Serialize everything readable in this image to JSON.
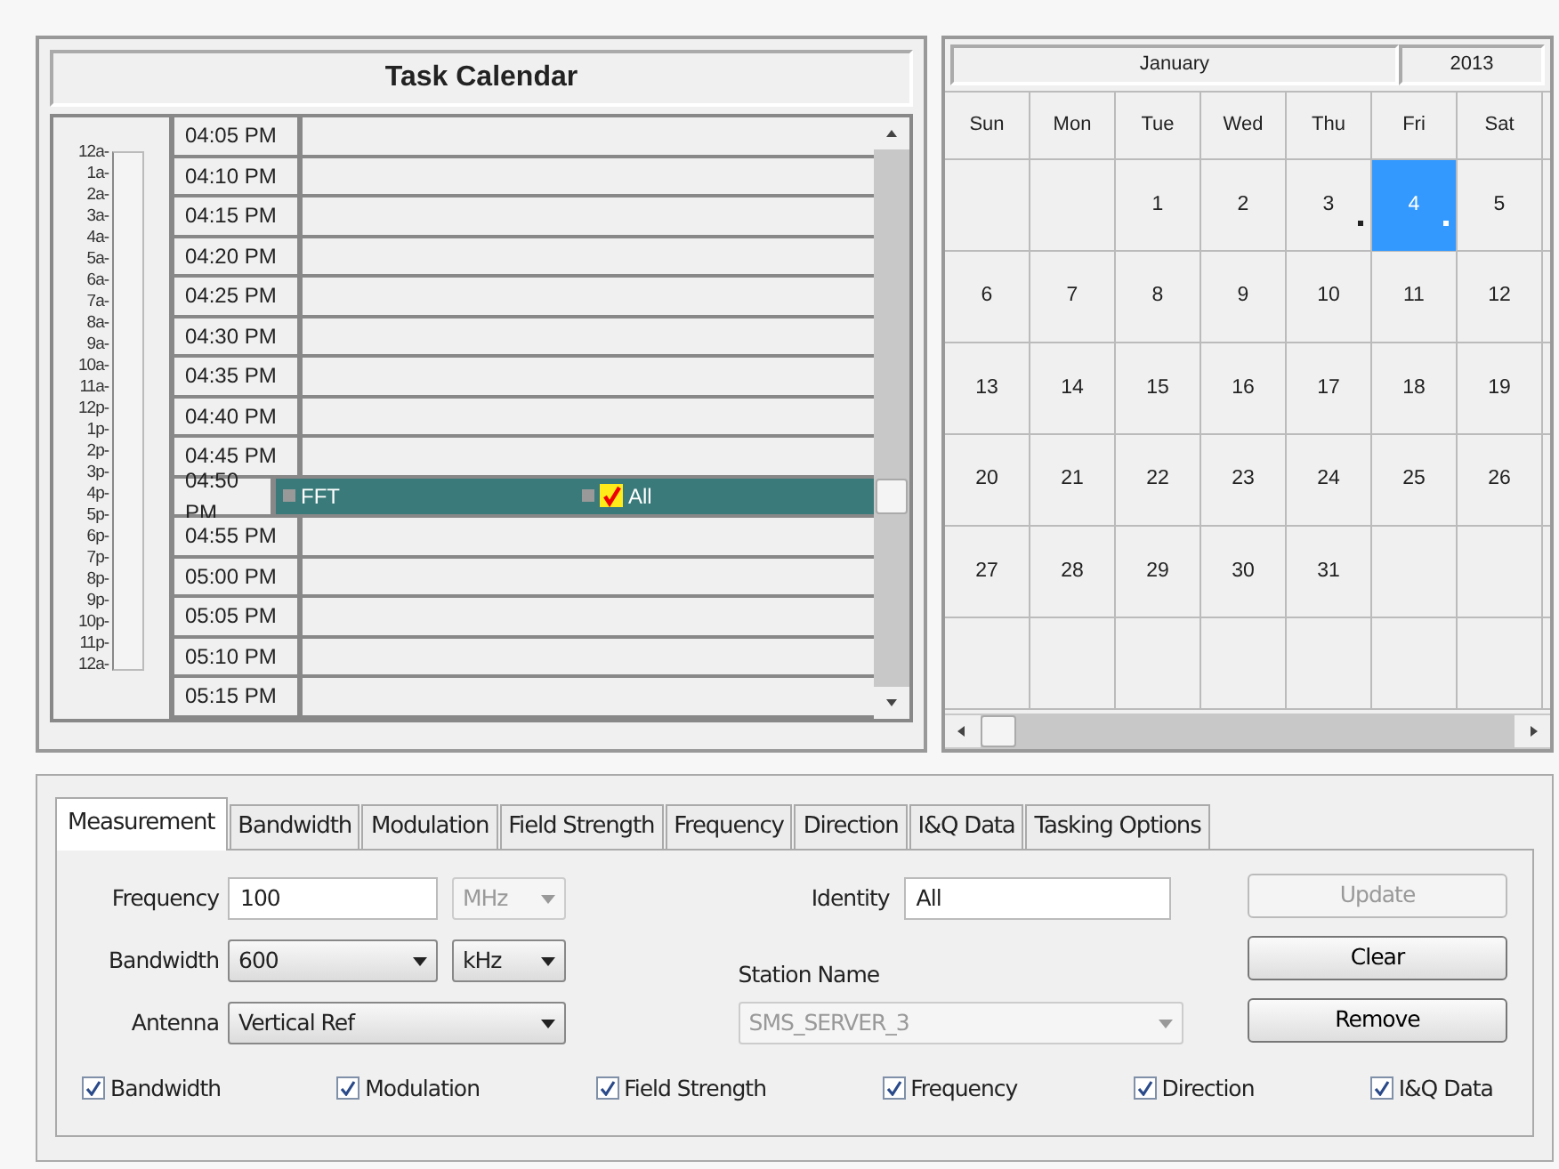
{
  "task_calendar": {
    "title": "Task Calendar",
    "hour_labels": [
      "12a-",
      "1a-",
      "2a-",
      "3a-",
      "4a-",
      "5a-",
      "6a-",
      "7a-",
      "8a-",
      "9a-",
      "10a-",
      "11a-",
      "12p-",
      "1p-",
      "2p-",
      "3p-",
      "4p-",
      "5p-",
      "6p-",
      "7p-",
      "8p-",
      "9p-",
      "10p-",
      "11p-",
      "12a-"
    ],
    "slots": [
      {
        "time": "04:05 PM",
        "selected": false
      },
      {
        "time": "04:10 PM",
        "selected": false
      },
      {
        "time": "04:15 PM",
        "selected": false
      },
      {
        "time": "04:20 PM",
        "selected": false
      },
      {
        "time": "04:25 PM",
        "selected": false
      },
      {
        "time": "04:30 PM",
        "selected": false
      },
      {
        "time": "04:35 PM",
        "selected": false
      },
      {
        "time": "04:40 PM",
        "selected": false
      },
      {
        "time": "04:45 PM",
        "selected": false
      },
      {
        "time": "04:50 PM",
        "selected": true,
        "tasks": [
          {
            "label": "FFT",
            "checked": false
          },
          {
            "label": "All",
            "checked": true
          }
        ]
      },
      {
        "time": "04:55 PM",
        "selected": false
      },
      {
        "time": "05:00 PM",
        "selected": false
      },
      {
        "time": "05:05 PM",
        "selected": false
      },
      {
        "time": "05:10 PM",
        "selected": false
      },
      {
        "time": "05:15 PM",
        "selected": false
      }
    ]
  },
  "month_calendar": {
    "month": "January",
    "year": "2013",
    "weekdays": [
      "Sun",
      "Mon",
      "Tue",
      "Wed",
      "Thu",
      "Fri",
      "Sat"
    ],
    "weeks": [
      [
        {
          "kind": "blank"
        },
        {
          "kind": "blank"
        },
        {
          "day": "1",
          "selected": false,
          "marked": false
        },
        {
          "day": "2",
          "selected": false,
          "marked": false
        },
        {
          "day": "3",
          "selected": false,
          "marked": true
        },
        {
          "day": "4",
          "selected": true,
          "marked": true
        },
        {
          "day": "5",
          "selected": false,
          "marked": false
        }
      ],
      [
        {
          "day": "6",
          "selected": false,
          "marked": false
        },
        {
          "day": "7",
          "selected": false,
          "marked": false
        },
        {
          "day": "8",
          "selected": false,
          "marked": false
        },
        {
          "day": "9",
          "selected": false,
          "marked": false
        },
        {
          "day": "10",
          "selected": false,
          "marked": false
        },
        {
          "day": "11",
          "selected": false,
          "marked": false
        },
        {
          "day": "12",
          "selected": false,
          "marked": false
        }
      ],
      [
        {
          "day": "13",
          "selected": false,
          "marked": false
        },
        {
          "day": "14",
          "selected": false,
          "marked": false
        },
        {
          "day": "15",
          "selected": false,
          "marked": false
        },
        {
          "day": "16",
          "selected": false,
          "marked": false
        },
        {
          "day": "17",
          "selected": false,
          "marked": false
        },
        {
          "day": "18",
          "selected": false,
          "marked": false
        },
        {
          "day": "19",
          "selected": false,
          "marked": false
        }
      ],
      [
        {
          "day": "20",
          "selected": false,
          "marked": false
        },
        {
          "day": "21",
          "selected": false,
          "marked": false
        },
        {
          "day": "22",
          "selected": false,
          "marked": false
        },
        {
          "day": "23",
          "selected": false,
          "marked": false
        },
        {
          "day": "24",
          "selected": false,
          "marked": false
        },
        {
          "day": "25",
          "selected": false,
          "marked": false
        },
        {
          "day": "26",
          "selected": false,
          "marked": false
        }
      ],
      [
        {
          "day": "27",
          "selected": false,
          "marked": false
        },
        {
          "day": "28",
          "selected": false,
          "marked": false
        },
        {
          "day": "29",
          "selected": false,
          "marked": false
        },
        {
          "day": "30",
          "selected": false,
          "marked": false
        },
        {
          "day": "31",
          "selected": false,
          "marked": false
        },
        {
          "kind": "blank"
        },
        {
          "kind": "blank"
        }
      ]
    ]
  },
  "tabs": [
    {
      "label": "Measurement",
      "selected": true
    },
    {
      "label": "Bandwidth",
      "selected": false
    },
    {
      "label": "Modulation",
      "selected": false
    },
    {
      "label": "Field Strength",
      "selected": false
    },
    {
      "label": "Frequency",
      "selected": false
    },
    {
      "label": "Direction",
      "selected": false
    },
    {
      "label": "I&Q Data",
      "selected": false
    },
    {
      "label": "Tasking Options",
      "selected": false
    }
  ],
  "form": {
    "frequency": {
      "label": "Frequency",
      "value": "100",
      "unit": "MHz",
      "unit_disabled": true
    },
    "bandwidth": {
      "label": "Bandwidth",
      "value": "600",
      "unit": "kHz"
    },
    "antenna": {
      "label": "Antenna",
      "value": "Vertical Ref"
    },
    "identity": {
      "label": "Identity",
      "value": "All"
    },
    "station_name": {
      "label": "Station Name",
      "value": "SMS_SERVER_3",
      "disabled": true
    }
  },
  "buttons": [
    {
      "label": "Update",
      "disabled": true
    },
    {
      "label": "Clear",
      "disabled": false
    },
    {
      "label": "Remove",
      "disabled": false
    }
  ],
  "checkboxes": [
    {
      "label": "Bandwidth",
      "checked": true
    },
    {
      "label": "Modulation",
      "checked": true
    },
    {
      "label": "Field Strength",
      "checked": true
    },
    {
      "label": "Frequency",
      "checked": true
    },
    {
      "label": "Direction",
      "checked": true
    },
    {
      "label": "I&Q Data",
      "checked": true
    }
  ]
}
